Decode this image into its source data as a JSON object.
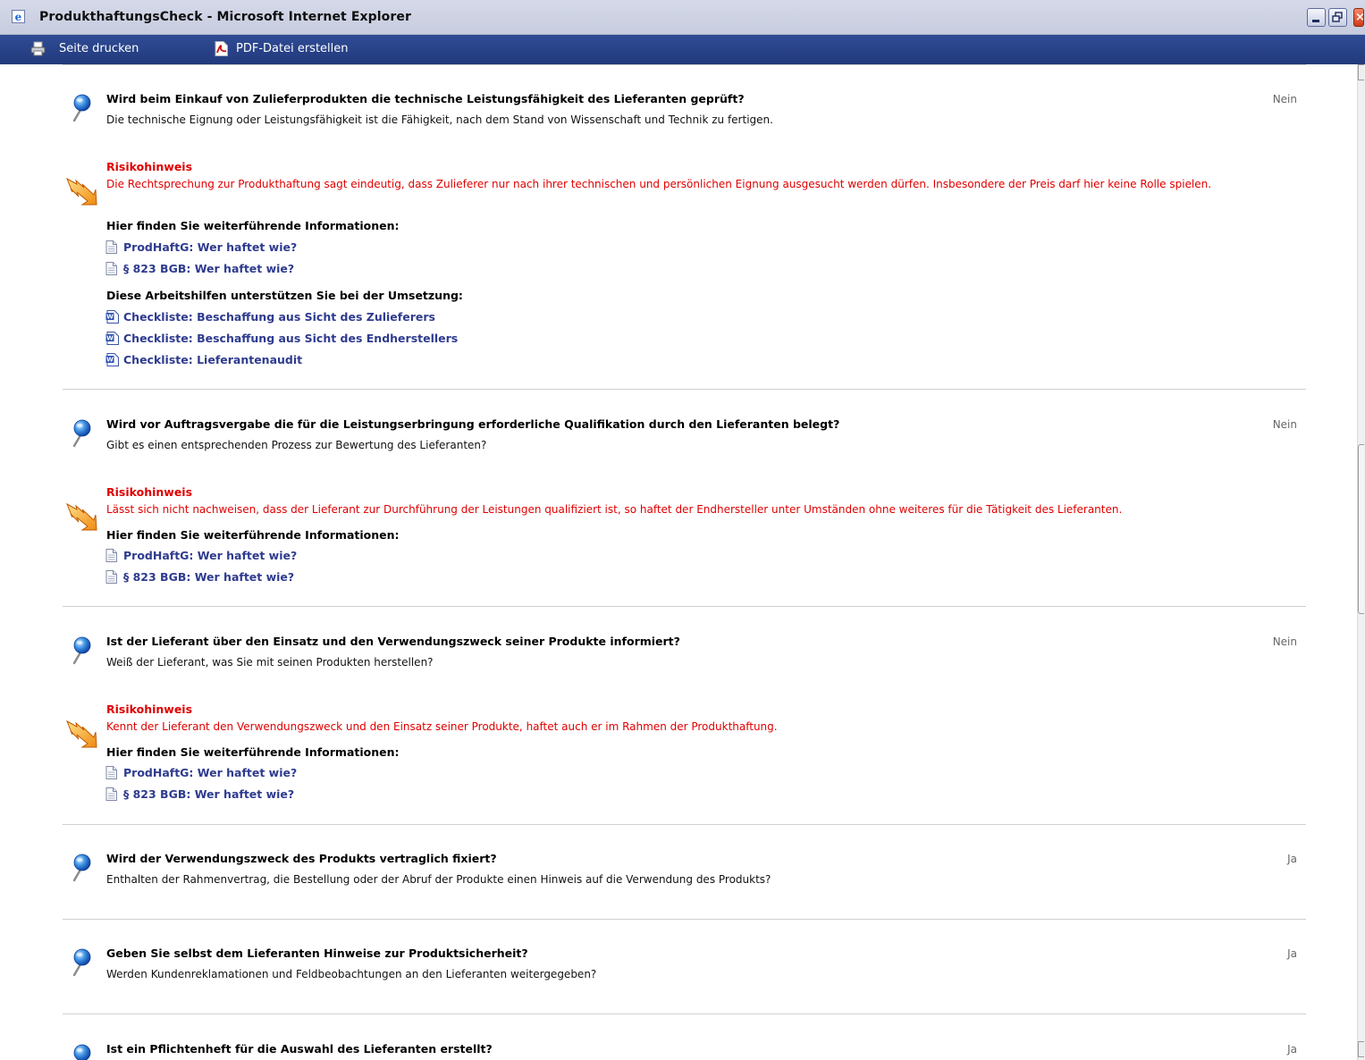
{
  "window": {
    "title": "ProdukthaftungsCheck - Microsoft Internet Explorer"
  },
  "toolbar": {
    "print_label": "Seite drucken",
    "pdf_label": "PDF-Datei erstellen"
  },
  "labels": {
    "risk_heading": "Risikohinweis",
    "info_heading": "Hier finden Sie weiterführende Informationen:",
    "tools_heading": "Diese Arbeitshilfen unterstützen Sie bei der Umsetzung:"
  },
  "questions": [
    {
      "title": "Wird beim Einkauf von Zulieferprodukten die technische Leistungsfähigkeit des Lieferanten geprüft?",
      "description": "Die technische Eignung oder Leistungsfähigkeit ist die Fähigkeit, nach dem Stand von Wissenschaft und Technik zu fertigen.",
      "answer": "Nein",
      "risk_text": "Die Rechtsprechung zur Produkthaftung sagt eindeutig, dass Zulieferer nur nach ihrer technischen und persönlichen Eignung ausgesucht werden dürfen. Insbesondere der Preis darf hier keine Rolle spielen.",
      "info_links": [
        "ProdHaftG: Wer haftet wie?",
        "§ 823 BGB: Wer haftet wie?"
      ],
      "tool_links": [
        "Checkliste: Beschaffung aus Sicht des Zulieferers",
        "Checkliste: Beschaffung aus Sicht des Endherstellers",
        "Checkliste: Lieferantenaudit"
      ]
    },
    {
      "title": "Wird vor Auftragsvergabe die für die Leistungserbringung erforderliche Qualifikation durch den Lieferanten belegt?",
      "description": "Gibt es einen entsprechenden Prozess zur Bewertung des Lieferanten?",
      "answer": "Nein",
      "risk_text": "Lässt sich nicht nachweisen, dass der Lieferant zur Durchführung der Leistungen qualifiziert ist, so haftet der Endhersteller unter Umständen ohne weiteres für die Tätigkeit des Lieferanten.",
      "info_links": [
        "ProdHaftG: Wer haftet wie?",
        "§ 823 BGB: Wer haftet wie?"
      ]
    },
    {
      "title": "Ist der Lieferant über den Einsatz und den Verwendungszweck seiner Produkte informiert?",
      "description": "Weiß der Lieferant, was Sie mit seinen Produkten herstellen?",
      "answer": "Nein",
      "risk_text": "Kennt der Lieferant den Verwendungszweck und den Einsatz seiner Produkte, haftet auch er im Rahmen der Produkthaftung.",
      "info_links": [
        "ProdHaftG: Wer haftet wie?",
        "§ 823 BGB: Wer haftet wie?"
      ]
    },
    {
      "title": "Wird der Verwendungszweck des Produkts vertraglich fixiert?",
      "description": "Enthalten der Rahmenvertrag, die Bestellung oder der Abruf der Produkte einen Hinweis auf die Verwendung des Produkts?",
      "answer": "Ja"
    },
    {
      "title": "Geben Sie selbst dem Lieferanten Hinweise zur Produktsicherheit?",
      "description": "Werden Kundenreklamationen und Feldbeobachtungen an den Lieferanten weitergegeben?",
      "answer": "Ja"
    },
    {
      "title": "Ist ein Pflichtenheft für die Auswahl des Lieferanten erstellt?",
      "answer": "Ja"
    }
  ]
}
